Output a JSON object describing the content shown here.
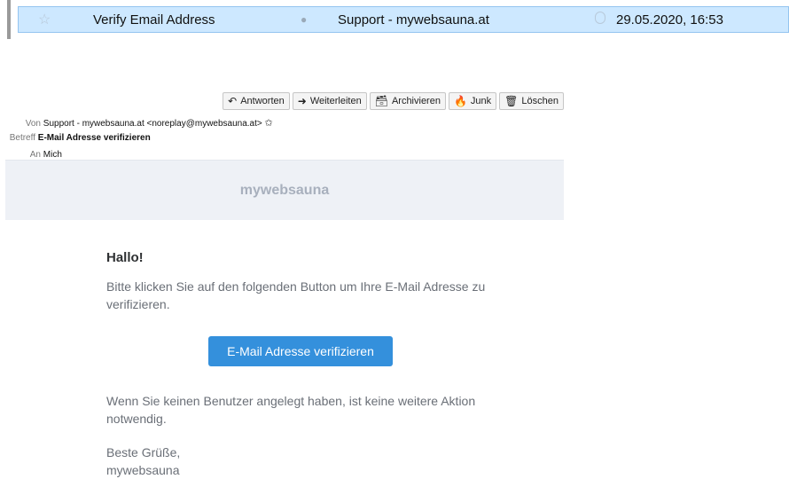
{
  "message_list": {
    "row": {
      "subject": "Verify Email Address",
      "sender": "Support - mywebsauna.at",
      "date": "29.05.2020, 16:53",
      "star_icon": "star-outline-icon",
      "read_icon": "read-status-icon"
    }
  },
  "toolbar": {
    "reply": {
      "label": "Antworten",
      "icon": "reply-icon"
    },
    "forward": {
      "label": "Weiterleiten",
      "icon": "forward-icon"
    },
    "archive": {
      "label": "Archivieren",
      "icon": "archive-icon"
    },
    "junk": {
      "label": "Junk",
      "icon": "junk-icon"
    },
    "delete": {
      "label": "Löschen",
      "icon": "trash-icon"
    }
  },
  "headers": {
    "from_label": "Von",
    "from_value": "Support - mywebsauna.at <noreplay@mywebsauna.at>",
    "subject_label": "Betreff",
    "subject_value": "E-Mail Adresse verifizieren",
    "to_label": "An",
    "to_value": "Mich"
  },
  "email": {
    "brand": "mywebsauna",
    "greeting": "Hallo!",
    "paragraph1": "Bitte klicken Sie auf den folgenden Button um Ihre E-Mail Adresse zu verifizieren.",
    "button_label": "E-Mail Adresse verifizieren",
    "paragraph2": "Wenn Sie keinen Benutzer angelegt haben, ist keine weitere Aktion notwendig.",
    "signoff_line1": "Beste Grüße,",
    "signoff_line2": "mywebsauna"
  },
  "colors": {
    "selected_row": "#cde8ff",
    "button": "#3490dc",
    "brand_band": "#eef1f6"
  }
}
